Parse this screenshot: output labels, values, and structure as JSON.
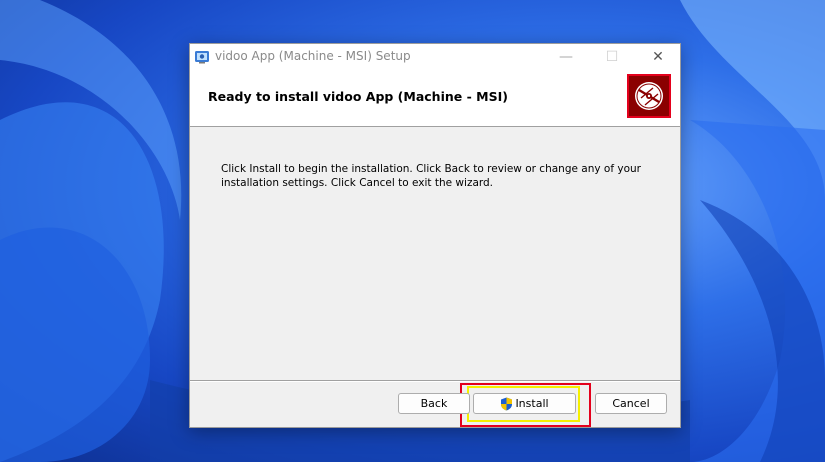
{
  "window": {
    "title": "vidoo App (Machine - MSI) Setup",
    "minimize_glyph": "—",
    "maximize_glyph": "☐",
    "close_glyph": "✕"
  },
  "header": {
    "title": "Ready to install vidoo App (Machine - MSI)",
    "icon": "install-disc-icon"
  },
  "body": {
    "text": "Click Install to begin the installation. Click Back to review or change any of your installation settings. Click Cancel to exit the wizard."
  },
  "buttons": {
    "back_label": "Back",
    "install_label": "Install",
    "install_icon": "uac-shield-icon",
    "cancel_label": "Cancel"
  },
  "colors": {
    "highlight_red": "#e4001c",
    "highlight_yellow": "#f5f000",
    "banner_icon_bg": "#8b0000"
  }
}
